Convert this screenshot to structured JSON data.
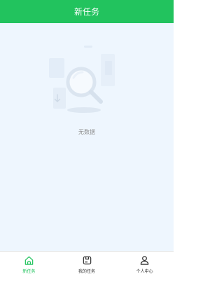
{
  "header": {
    "title": "新任务"
  },
  "empty_state": {
    "text": "无数据",
    "icon": "magnifier-illustration"
  },
  "tabbar": {
    "active": "new_task",
    "items": [
      {
        "key": "new_task",
        "label": "新任务",
        "icon": "home-icon"
      },
      {
        "key": "my_tasks",
        "label": "我的任务",
        "icon": "task-box-icon"
      },
      {
        "key": "profile",
        "label": "个人中心",
        "icon": "person-icon"
      }
    ]
  },
  "colors": {
    "accent": "#22c35e",
    "content_bg": "#eef6fe"
  }
}
